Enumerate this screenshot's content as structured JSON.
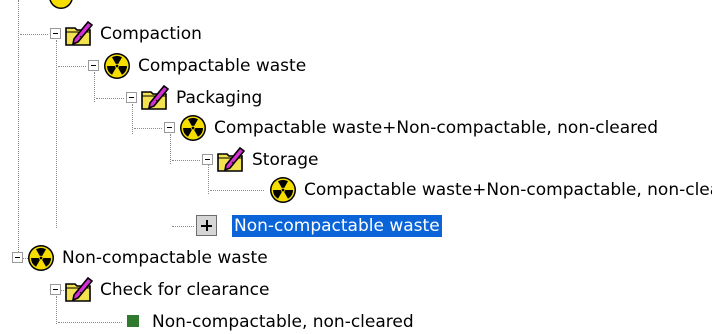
{
  "tree": {
    "nodes": [
      {
        "label": "",
        "icon": "partial-node-icon"
      },
      {
        "label": "Compaction",
        "icon": "process-folder-icon"
      },
      {
        "label": "Compactable waste",
        "icon": "radiation-icon"
      },
      {
        "label": "Packaging",
        "icon": "process-folder-icon"
      },
      {
        "label": "Compactable waste+Non-compactable, non-cleared",
        "icon": "radiation-icon"
      },
      {
        "label": "Storage",
        "icon": "process-folder-icon"
      },
      {
        "label": "Compactable waste+Non-compactable, non-cleared",
        "icon": "radiation-icon"
      },
      {
        "label": "Non-compactable waste",
        "icon": "plus-box-icon",
        "selected": true
      },
      {
        "label": "Non-compactable waste",
        "icon": "radiation-icon"
      },
      {
        "label": "Check for clearance",
        "icon": "process-folder-icon"
      },
      {
        "label": "Non-compactable, non-cleared",
        "icon": "green-square-icon"
      }
    ]
  },
  "colors": {
    "selection": "#0a64d8",
    "radiation_yellow": "#f5dd00",
    "folder_yellow": "#f2e24f",
    "pencil_magenta": "#d42fd4"
  }
}
